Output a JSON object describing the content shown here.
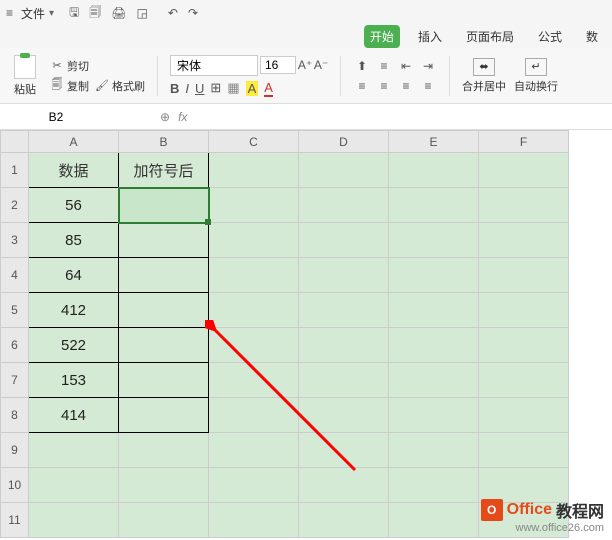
{
  "titlebar": {
    "file_label": "文件"
  },
  "tabs": {
    "start": "开始",
    "insert": "插入",
    "layout": "页面布局",
    "formula": "公式",
    "data": "数"
  },
  "ribbon": {
    "paste": "粘贴",
    "cut": "剪切",
    "copy": "复制",
    "format_painter": "格式刷",
    "font_name": "宋体",
    "font_size": "16",
    "merge_center": "合并居中",
    "auto_wrap": "自动换行"
  },
  "namebox": {
    "cell_ref": "B2"
  },
  "sheet": {
    "columns": [
      "A",
      "B",
      "C",
      "D",
      "E",
      "F"
    ],
    "row_headers": [
      "1",
      "2",
      "3",
      "4",
      "5",
      "6",
      "7",
      "8",
      "9",
      "10",
      "11"
    ],
    "header_row": {
      "A": "数据",
      "B": "加符号后"
    },
    "data_rows": [
      {
        "A": "56",
        "B": ""
      },
      {
        "A": "85",
        "B": ""
      },
      {
        "A": "64",
        "B": ""
      },
      {
        "A": "412",
        "B": ""
      },
      {
        "A": "522",
        "B": ""
      },
      {
        "A": "153",
        "B": ""
      },
      {
        "A": "414",
        "B": ""
      }
    ],
    "selected_cell": "B2"
  },
  "watermark": {
    "brand1": "Office",
    "brand2": "教程网",
    "url": "www.office26.com"
  }
}
